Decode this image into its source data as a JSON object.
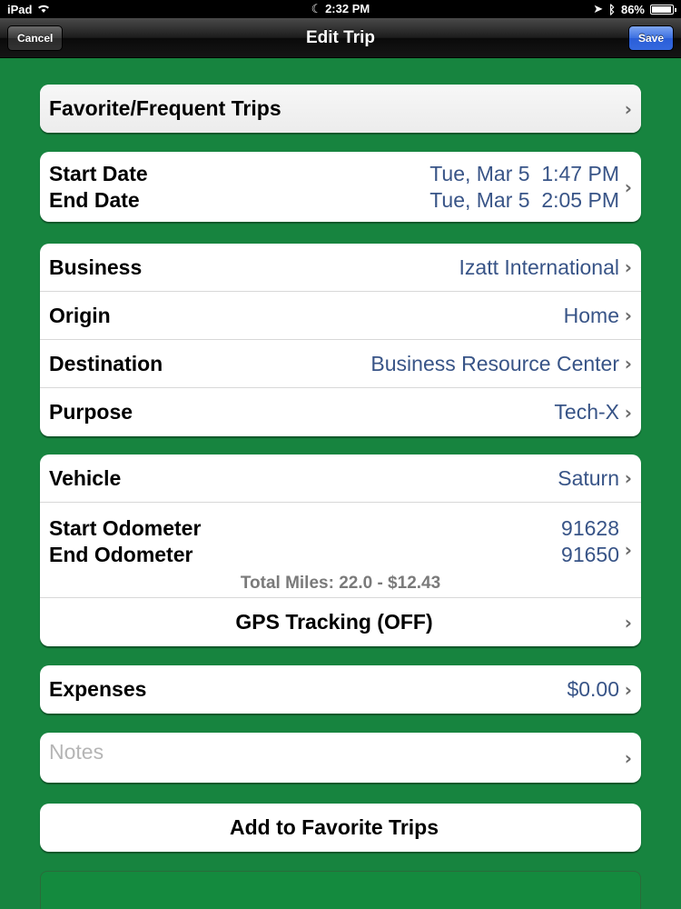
{
  "status_bar": {
    "device": "iPad",
    "time": "2:32 PM",
    "battery": "86%"
  },
  "nav": {
    "title": "Edit Trip",
    "cancel_label": "Cancel",
    "save_label": "Save"
  },
  "favorites": {
    "label": "Favorite/Frequent Trips"
  },
  "dates": {
    "start_label": "Start Date",
    "end_label": "End Date",
    "start_value": "Tue, Mar 5  1:47 PM",
    "end_value": "Tue, Mar 5  2:05 PM"
  },
  "trip_fields": [
    {
      "label": "Business",
      "value": "Izatt International"
    },
    {
      "label": "Origin",
      "value": "Home"
    },
    {
      "label": "Destination",
      "value": "Business Resource Center"
    },
    {
      "label": "Purpose",
      "value": "Tech-X"
    }
  ],
  "vehicle": {
    "label": "Vehicle",
    "value": "Saturn",
    "start_odo_label": "Start Odometer",
    "end_odo_label": "End Odometer",
    "start_odo_value": "91628",
    "end_odo_value": "91650",
    "total_miles": "Total Miles: 22.0 - $12.43",
    "gps_label": "GPS Tracking (OFF)"
  },
  "expenses": {
    "label": "Expenses",
    "value": "$0.00"
  },
  "notes": {
    "placeholder": "Notes"
  },
  "add_favorite": {
    "label": "Add to Favorite Trips"
  },
  "colors": {
    "background": "#17843f",
    "value_text": "#385487",
    "save_button": "#2a5ed8"
  }
}
